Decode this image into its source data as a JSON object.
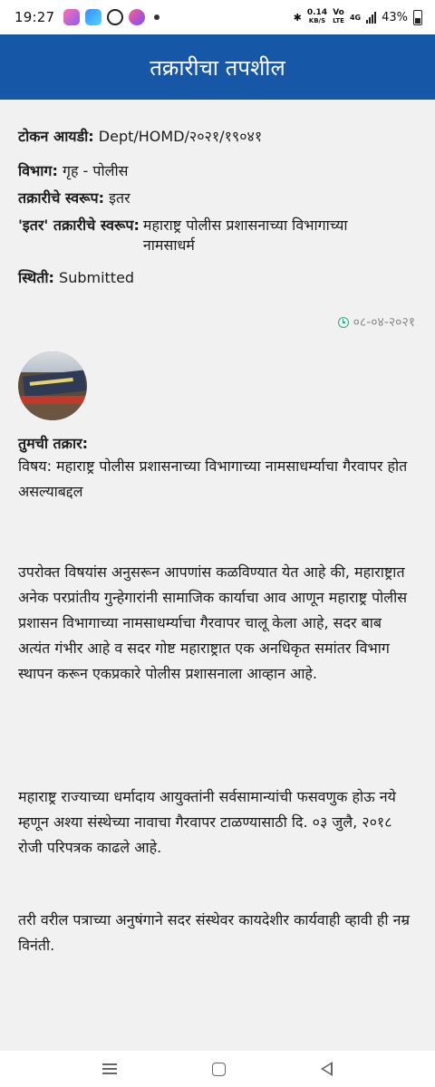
{
  "status_bar": {
    "time": "19:27",
    "speed_value": "0.14",
    "speed_unit": "KB/S",
    "volte_top": "Vo",
    "volte_bottom": "LTE",
    "network": "4G",
    "battery": "43%"
  },
  "header": {
    "title": "तक्रारीचा तपशील"
  },
  "details": {
    "token_label": "टोकन आयडी:",
    "token_value": "Dept/HOMD/२०२१/१९०४१",
    "department_label": "विभाग:",
    "department_value": "गृह - पोलीस",
    "nature_label": "तक्रारीचे स्वरूप:",
    "nature_value": "इतर",
    "other_nature_label": "'इतर' तक्रारीचे स्वरूप:",
    "other_nature_value": "महाराष्ट्र पोलीस प्रशासनाच्या विभागाच्या नामसाधर्म",
    "status_label": "स्थिती:",
    "status_value": "Submitted",
    "date": "०८-०४-२०२१"
  },
  "complaint": {
    "label": "तुमची तक्रार:",
    "subject": "विषय: महाराष्ट्र पोलीस प्रशासनाच्या विभागाच्या नामसाधर्म्याचा गैरवापर होत असल्याबद्दल",
    "paragraph_1": "उपरोक्त विषयांस अनुसरून आपणांस कळविण्यात येत आहे की, महाराष्ट्रात अनेक परप्रांतीय गुन्हेगारांनी सामाजिक कार्याचा आव आणून महाराष्ट्र पोलीस प्रशासन विभागाच्या नामसाधर्म्याचा गैरवापर चालू केला आहे, सदर बाब अत्यंत गंभीर आहे व सदर गोष्ट महाराष्ट्रात एक अनधिकृत समांतर विभाग स्थापन करून एकप्रकारे पोलीस प्रशासनाला आव्हान आहे.",
    "paragraph_2": "महाराष्ट्र राज्याच्या धर्मादाय आयुक्तांनी सर्वसामान्यांची फसवणुक होऊ नये म्हणून अश्या संस्थेच्या नावाचा गैरवापर टाळण्यासाठी दि. ०३ जुलै, २०१८ रोजी परिपत्रक काढले आहे.",
    "paragraph_3": "तरी वरील पत्राच्या अनुषंगाने सदर संस्थेवर कायदेशीर कार्यवाही व्हावी ही नम्र विनंती."
  },
  "icons": {
    "clock": "clock-icon",
    "nav_recents": "menu-lines-icon",
    "nav_home": "home-square-icon",
    "nav_back": "back-triangle-icon"
  },
  "colors": {
    "header_bg": "#1657a8",
    "panel_bg": "#f1f1f1",
    "clock_accent": "#2fa58a"
  }
}
